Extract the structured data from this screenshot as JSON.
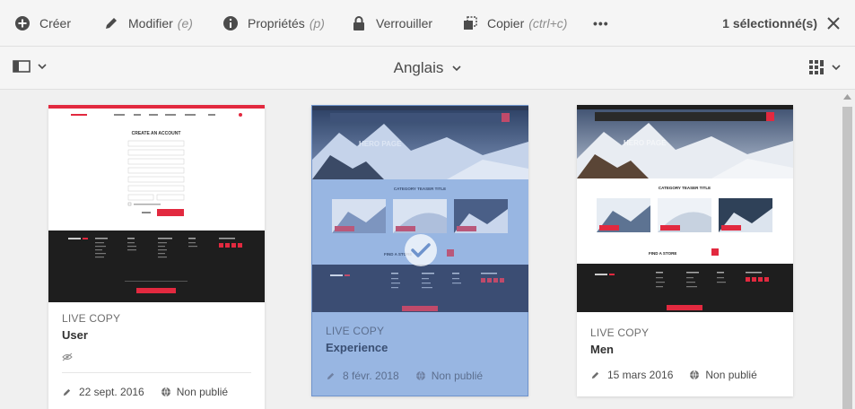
{
  "toolbar": {
    "create_label": "Créer",
    "edit_label": "Modifier",
    "edit_shortcut": "(e)",
    "properties_label": "Propriétés",
    "properties_shortcut": "(p)",
    "lock_label": "Verrouiller",
    "copy_label": "Copier",
    "copy_shortcut": "(ctrl+c)",
    "more_label": "•••",
    "selection_count": "1 sélectionné(s)"
  },
  "subheader": {
    "language": "Anglais"
  },
  "colors": {
    "selected_bg": "#98b6e2",
    "brand_red": "#e2293f",
    "footer_dark": "#1e1e1e"
  },
  "cards": [
    {
      "type": "LIVE COPY",
      "title": "User",
      "modified": "22 sept. 2016",
      "status": "Non publié",
      "selected": false,
      "thumb_heading": "CREATE AN ACCOUNT"
    },
    {
      "type": "LIVE COPY",
      "title": "Experience",
      "modified": "8 févr. 2018",
      "status": "Non publié",
      "selected": true,
      "thumb_heading": "HERO PAGE",
      "thumb_teaser": "CATEGORY TEASER TITLE",
      "thumb_store": "FIND A STORE"
    },
    {
      "type": "LIVE COPY",
      "title": "Men",
      "modified": "15 mars 2016",
      "status": "Non publié",
      "selected": false,
      "thumb_heading": "HERO PAGE",
      "thumb_teaser": "CATEGORY TEASER TITLE",
      "thumb_store": "FIND A STORE"
    }
  ]
}
